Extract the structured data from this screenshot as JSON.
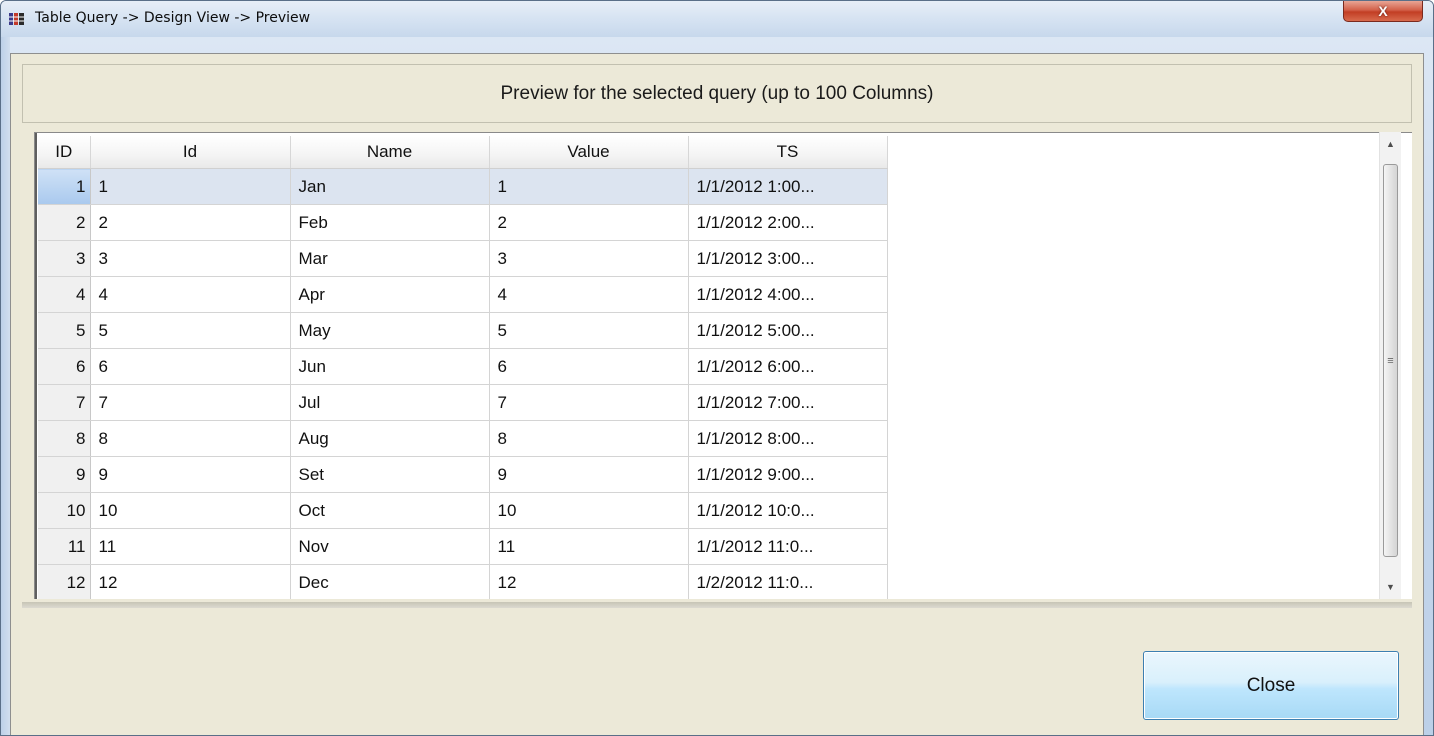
{
  "window": {
    "title": "Table Query -> Design View -> Preview",
    "close_symbol": "X"
  },
  "header": {
    "text": "Preview for the selected query (up to 100 Columns)"
  },
  "grid": {
    "columns": [
      "ID",
      "Id",
      "Name",
      "Value",
      "TS"
    ],
    "rows": [
      {
        "row": "1",
        "id": "1",
        "name": "Jan",
        "value": "1",
        "ts": "1/1/2012 1:00..."
      },
      {
        "row": "2",
        "id": "2",
        "name": "Feb",
        "value": "2",
        "ts": "1/1/2012 2:00..."
      },
      {
        "row": "3",
        "id": "3",
        "name": "Mar",
        "value": "3",
        "ts": "1/1/2012 3:00..."
      },
      {
        "row": "4",
        "id": "4",
        "name": "Apr",
        "value": "4",
        "ts": "1/1/2012 4:00..."
      },
      {
        "row": "5",
        "id": "5",
        "name": "May",
        "value": "5",
        "ts": "1/1/2012 5:00..."
      },
      {
        "row": "6",
        "id": "6",
        "name": "Jun",
        "value": "6",
        "ts": "1/1/2012 6:00..."
      },
      {
        "row": "7",
        "id": "7",
        "name": "Jul",
        "value": "7",
        "ts": "1/1/2012 7:00..."
      },
      {
        "row": "8",
        "id": "8",
        "name": "Aug",
        "value": "8",
        "ts": "1/1/2012 8:00..."
      },
      {
        "row": "9",
        "id": "9",
        "name": "Set",
        "value": "9",
        "ts": "1/1/2012 9:00..."
      },
      {
        "row": "10",
        "id": "10",
        "name": "Oct",
        "value": "10",
        "ts": "1/1/2012 10:0..."
      },
      {
        "row": "11",
        "id": "11",
        "name": "Nov",
        "value": "11",
        "ts": "1/1/2012 11:0..."
      },
      {
        "row": "12",
        "id": "12",
        "name": "Dec",
        "value": "12",
        "ts": "1/2/2012 11:0..."
      }
    ],
    "selected_row": 1
  },
  "scrollbar": {
    "up_icon": "▲",
    "down_icon": "▼",
    "grip_icon": "≡"
  },
  "footer": {
    "close_label": "Close"
  },
  "icons": {
    "app_icon": "table-grid-icon"
  },
  "colors": {
    "selection": "#dce4f0",
    "client_bg": "#ece9d8",
    "close_button_border": "#3c7fb1",
    "title_close_red": "#c23e24"
  }
}
